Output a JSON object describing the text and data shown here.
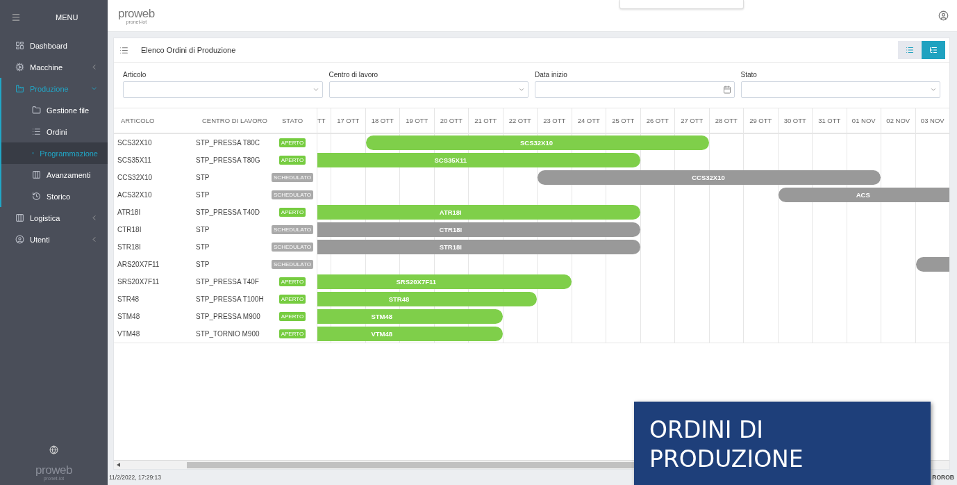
{
  "sidebar": {
    "title": "MENU",
    "items": [
      {
        "label": "Dashboard",
        "selected": false
      },
      {
        "label": "Macchine",
        "selected": false,
        "expanded": false
      },
      {
        "label": "Produzione",
        "selected": true,
        "expanded": true,
        "children": [
          {
            "label": "Gestione file",
            "selected": false
          },
          {
            "label": "Ordini",
            "selected": false
          },
          {
            "label": "Programmazione",
            "selected": true
          },
          {
            "label": "Avanzamenti",
            "selected": false
          },
          {
            "label": "Storico",
            "selected": false
          }
        ]
      },
      {
        "label": "Logistica",
        "selected": false,
        "expanded": false
      },
      {
        "label": "Utenti",
        "selected": false,
        "expanded": false
      }
    ],
    "logo": {
      "name": "proweb",
      "tagline": "pronet-iot"
    }
  },
  "header": {
    "logo": {
      "name": "proweb",
      "tagline": "pronet-iot"
    }
  },
  "panel": {
    "title": "Elenco Ordini di Produzione",
    "view_toggle": [
      {
        "kind": "list",
        "selected": false
      },
      {
        "kind": "gantt",
        "selected": true
      }
    ],
    "filters": [
      {
        "label": "Articolo",
        "kind": "select"
      },
      {
        "label": "Centro di lavoro",
        "kind": "select"
      },
      {
        "label": "Data inizio",
        "kind": "date"
      },
      {
        "label": "Stato",
        "kind": "select"
      }
    ],
    "table": {
      "columns": [
        "ARTICOLO",
        "CENTRO DI LAVORO",
        "STATO"
      ],
      "days": [
        "TT",
        "17 OTT",
        "18 OTT",
        "19 OTT",
        "20 OTT",
        "21 OTT",
        "22 OTT",
        "23 OTT",
        "24 OTT",
        "25 OTT",
        "26 OTT",
        "27 OTT",
        "28 OTT",
        "29 OTT",
        "30 OTT",
        "31 OTT",
        "01 NOV",
        "02 NOV",
        "03 NOV"
      ],
      "rows": [
        {
          "articolo": "SCS32X10",
          "centro": "STP_PRESSA T80C",
          "stato": "APERTO",
          "kind": "aperto",
          "bar": {
            "label": "SCS32X10",
            "active": [
              false,
              false,
              true,
              true,
              true,
              true,
              true,
              true,
              true,
              true,
              true,
              true,
              false,
              false,
              false,
              false,
              false,
              false,
              false
            ]
          }
        },
        {
          "articolo": "SCS35X11",
          "centro": "STP_PRESSA T80G",
          "stato": "APERTO",
          "kind": "aperto",
          "bar": {
            "label": "SCS35X11",
            "active": [
              true,
              true,
              true,
              true,
              true,
              true,
              true,
              true,
              true,
              true,
              false,
              false,
              false,
              false,
              false,
              false,
              false,
              false,
              false
            ]
          }
        },
        {
          "articolo": "CCS32X10",
          "centro": "STP",
          "stato": "SCHEDULATO",
          "kind": "schedulato",
          "bar": {
            "label": "CCS32X10",
            "active": [
              false,
              false,
              false,
              false,
              false,
              false,
              false,
              true,
              true,
              true,
              true,
              true,
              true,
              true,
              true,
              true,
              true,
              false,
              false
            ]
          }
        },
        {
          "articolo": "ACS32X10",
          "centro": "STP",
          "stato": "SCHEDULATO",
          "kind": "schedulato",
          "bar": {
            "label": "ACS",
            "active": [
              false,
              false,
              false,
              false,
              false,
              false,
              false,
              false,
              false,
              false,
              false,
              false,
              false,
              false,
              true,
              true,
              true,
              true,
              true
            ]
          }
        },
        {
          "articolo": "ATR18I",
          "centro": "STP_PRESSA T40D",
          "stato": "APERTO",
          "kind": "aperto",
          "bar": {
            "label": "ATR18I",
            "active": [
              true,
              true,
              true,
              true,
              true,
              true,
              true,
              true,
              true,
              true,
              false,
              false,
              false,
              false,
              false,
              false,
              false,
              false,
              false
            ]
          }
        },
        {
          "articolo": "CTR18I",
          "centro": "STP",
          "stato": "SCHEDULATO",
          "kind": "schedulato",
          "bar": {
            "label": "CTR18I",
            "active": [
              true,
              true,
              true,
              true,
              true,
              true,
              true,
              true,
              true,
              true,
              false,
              false,
              false,
              false,
              false,
              false,
              false,
              false,
              false
            ]
          }
        },
        {
          "articolo": "STR18I",
          "centro": "STP",
          "stato": "SCHEDULATO",
          "kind": "schedulato",
          "bar": {
            "label": "STR18I",
            "active": [
              true,
              true,
              true,
              true,
              true,
              true,
              true,
              true,
              true,
              true,
              false,
              false,
              false,
              false,
              false,
              false,
              false,
              false,
              false
            ]
          }
        },
        {
          "articolo": "ARS20X7F11",
          "centro": "STP",
          "stato": "SCHEDULATO",
          "kind": "schedulato",
          "bar": {
            "active": [
              false,
              false,
              false,
              false,
              false,
              false,
              false,
              false,
              false,
              false,
              false,
              false,
              false,
              false,
              false,
              false,
              false,
              false,
              true
            ]
          }
        },
        {
          "articolo": "SRS20X7F11",
          "centro": "STP_PRESSA T40F",
          "stato": "APERTO",
          "kind": "aperto",
          "bar": {
            "label": "SRS20X7F11",
            "active": [
              true,
              true,
              true,
              true,
              true,
              true,
              true,
              true,
              false,
              false,
              false,
              false,
              false,
              false,
              false,
              false,
              false,
              false,
              false
            ]
          }
        },
        {
          "articolo": "STR48",
          "centro": "STP_PRESSA T100H",
          "stato": "APERTO",
          "kind": "aperto",
          "bar": {
            "label": "STR48",
            "active": [
              true,
              true,
              true,
              true,
              true,
              true,
              true,
              false,
              false,
              false,
              false,
              false,
              false,
              false,
              false,
              false,
              false,
              false,
              false
            ]
          }
        },
        {
          "articolo": "STM48",
          "centro": "STP_PRESSA M900",
          "stato": "APERTO",
          "kind": "aperto",
          "bar": {
            "label": "STM48",
            "active": [
              true,
              true,
              true,
              true,
              true,
              true,
              false,
              false,
              false,
              false,
              false,
              false,
              false,
              false,
              false,
              false,
              false,
              false,
              false
            ]
          }
        },
        {
          "articolo": "VTM48",
          "centro": "STP_TORNIO M900",
          "stato": "APERTO",
          "kind": "aperto",
          "bar": {
            "label": "VTM48",
            "active": [
              true,
              true,
              true,
              true,
              true,
              true,
              false,
              false,
              false,
              false,
              false,
              false,
              false,
              false,
              false,
              false,
              false,
              false,
              false
            ]
          }
        }
      ]
    }
  },
  "status_bar": {
    "timestamp": "11/2/2022, 17:29:13",
    "right_text": "ROROB"
  },
  "caption": {
    "text": "ORDINI DI PRODUZIONE"
  }
}
